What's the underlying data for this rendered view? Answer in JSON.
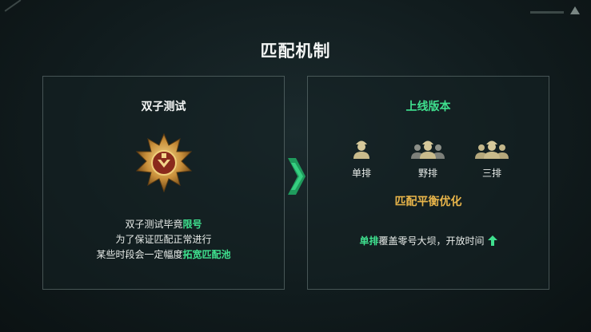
{
  "page": {
    "title": "匹配机制"
  },
  "left_panel": {
    "title": "双子测试",
    "medal_icon": "gold-rank-medal-icon",
    "lines": [
      {
        "before": "双子测试毕竟",
        "highlight": "限号",
        "after": ""
      },
      {
        "before": "为了保证匹配正常进行",
        "highlight": "",
        "after": ""
      },
      {
        "before": "某些时段会一定幅度",
        "highlight": "拓宽匹配池",
        "after": ""
      }
    ]
  },
  "right_panel": {
    "title": "上线版本",
    "modes": [
      {
        "label": "单排",
        "icon": "single-soldier-icon"
      },
      {
        "label": "野排",
        "icon": "wild-squad-icon"
      },
      {
        "label": "三排",
        "icon": "triple-squad-icon"
      }
    ],
    "balance_text": "匹配平衡优化",
    "open_line": {
      "highlight": "单排",
      "rest": "覆盖零号大坝，开放时间",
      "icon": "up-arrow-icon"
    }
  },
  "colors": {
    "accent_green": "#3fe08e",
    "accent_gold": "#e9b54a",
    "background": "#141f21"
  }
}
